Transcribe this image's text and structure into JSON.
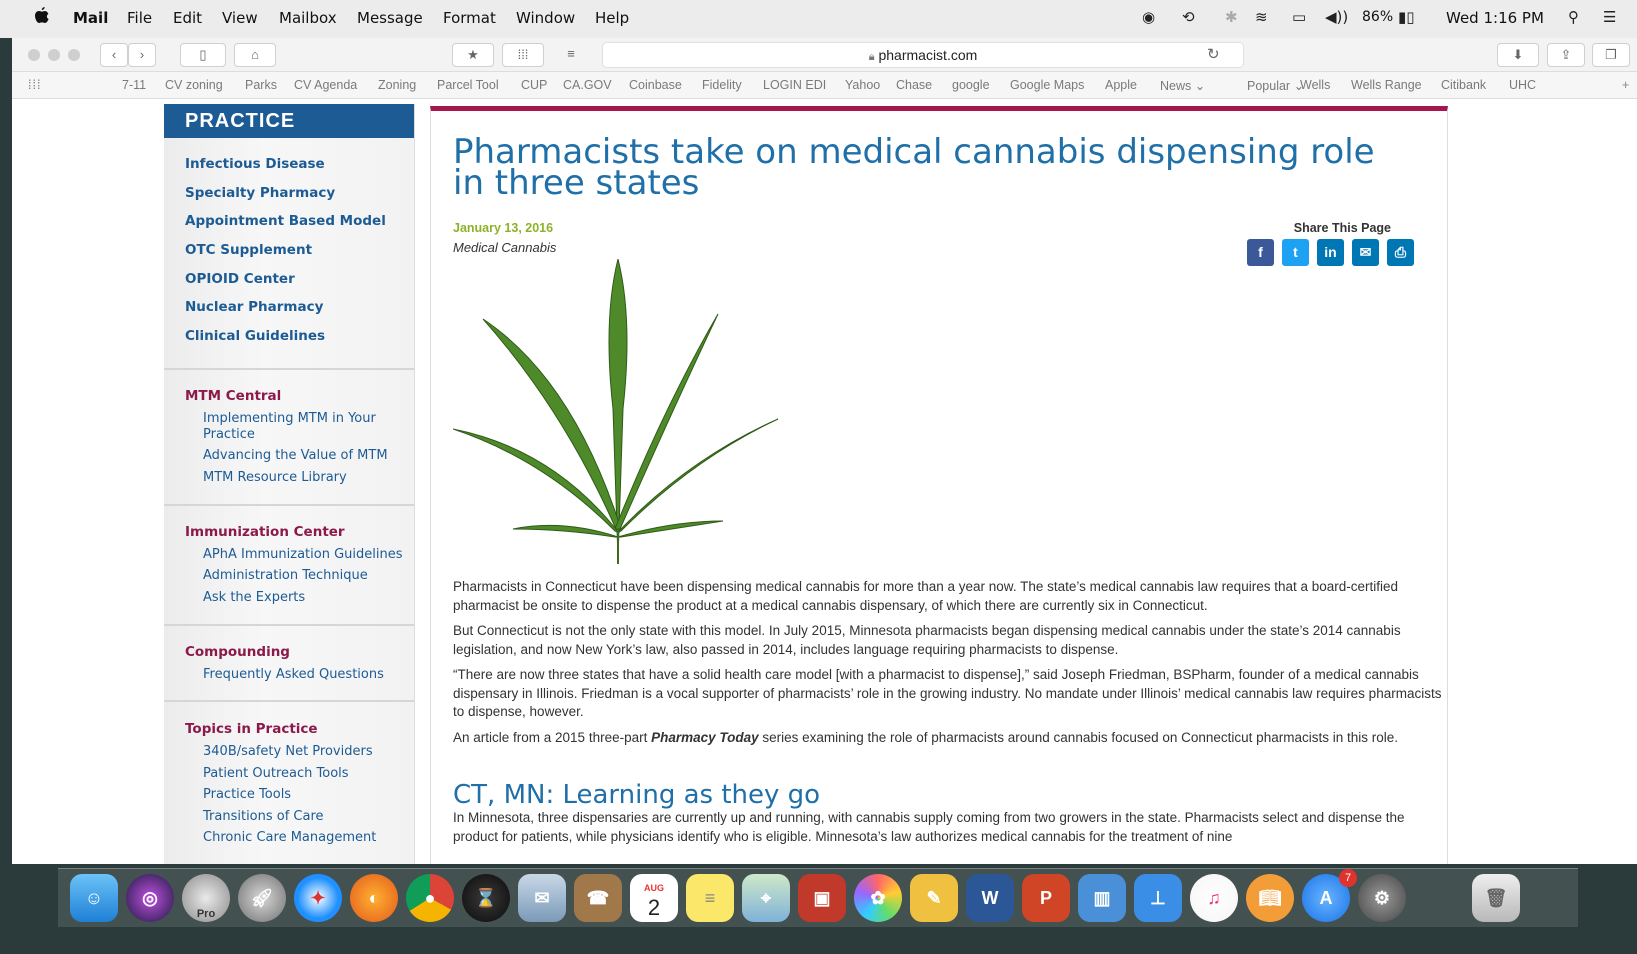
{
  "menubar": {
    "app": "Mail",
    "items": [
      "File",
      "Edit",
      "View",
      "Mailbox",
      "Message",
      "Format",
      "Window",
      "Help"
    ],
    "battery": "86%",
    "clock": "Wed 1:16 PM"
  },
  "browser": {
    "url": "pharmacist.com",
    "favorites": [
      "7-11",
      "CV zoning",
      "Parks",
      "CV Agenda",
      "Zoning",
      "Parcel Tool",
      "CUP",
      "CA.GOV",
      "Coinbase",
      "Fidelity",
      "LOGIN EDI",
      "Yahoo",
      "Chase",
      "google",
      "Google Maps",
      "Apple",
      "News",
      "Popular",
      "Wells",
      "Wells Range",
      "Citibank",
      "UHC"
    ]
  },
  "sidebar": {
    "heading": "PRACTICE",
    "links": [
      "Infectious Disease",
      "Specialty Pharmacy",
      "Appointment Based Model",
      "OTC Supplement",
      "OPIOID Center",
      "Nuclear Pharmacy",
      "Clinical Guidelines"
    ],
    "sections": [
      {
        "title": "MTM Central",
        "items": [
          "Implementing MTM in Your Practice",
          "Advancing the Value of MTM",
          "MTM Resource Library"
        ]
      },
      {
        "title": "Immunization Center",
        "items": [
          "APhA Immunization Guidelines",
          "Administration Technique",
          "Ask the Experts"
        ]
      },
      {
        "title": "Compounding",
        "items": [
          "Frequently Asked Questions"
        ]
      },
      {
        "title": "Topics in Practice",
        "items": [
          "340B/safety Net Providers",
          "Patient Outreach Tools",
          "Practice Tools",
          "Transitions of Care",
          "Chronic Care Management"
        ]
      }
    ]
  },
  "article": {
    "title": "Pharmacists take on medical cannabis dispensing role in three states",
    "date": "January 13, 2016",
    "category": "Medical Cannabis",
    "share_label": "Share This Page",
    "paragraphs": [
      "Pharmacists in Connecticut have been dispensing medical cannabis for more than a year now. The state’s medical cannabis law requires that a board-certified pharmacist be onsite to dispense the product at a medical cannabis dispensary, of which there are currently six in Connecticut.",
      "But Connecticut is not the only state with this model. In July 2015, Minnesota pharmacists began dispensing medical cannabis under the state’s 2014 cannabis legislation, and now New York’s law, also passed in 2014, includes language requiring pharmacists to dispense.",
      "“There are now three states that have a solid health care model [with a pharmacist to dispense],” said Joseph Friedman, BSPharm, founder of a medical cannabis dispensary in Illinois. Friedman is a vocal supporter of pharmacists’ role in the growing industry. No mandate under Illinois’ medical cannabis law requires pharmacists to dispense, however."
    ],
    "p4_before": "An article from a 2015 three-part ",
    "p4_em": "Pharmacy Today",
    "p4_after": " series examining the role of pharmacists around cannabis focused on Connecticut pharmacists in this role.",
    "subheading": "CT, MN: Learning as they go",
    "p5": "In Minnesota, three dispensaries are currently up and running, with cannabis supply coming from two growers in the state. Pharmacists select and dispense the product for patients, while physicians identify who is eligible. Minnesota’s law authorizes medical cannabis for the treatment of nine"
  },
  "dock": {
    "calendar_month": "AUG",
    "calendar_day": "2",
    "appstore_badge": "7",
    "earth_label": "Pro"
  }
}
